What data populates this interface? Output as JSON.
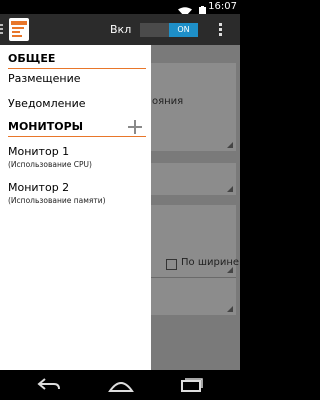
{
  "status_bar": {
    "time": "16:07",
    "wifi_icon": "wifi-icon",
    "battery_icon": "battery-icon"
  },
  "action_bar": {
    "toggle_label": "Вкл",
    "toggle_state": "ON",
    "overflow_icon": "overflow-menu-icon"
  },
  "background": {
    "card1_text": "ояния",
    "checkbox_label": "По ширине"
  },
  "drawer": {
    "general_header": "ОБЩЕЕ",
    "items": [
      {
        "label": "Размещение"
      },
      {
        "label": "Уведомление"
      }
    ],
    "monitors_header": "МОНИТОРЫ",
    "monitors": [
      {
        "title": "Монитор 1",
        "subtitle": "(Использование CPU)"
      },
      {
        "title": "Монитор 2",
        "subtitle": "(Использование памяти)"
      }
    ]
  },
  "colors": {
    "accent": "#e8762a",
    "toggle_on": "#1e8fc8",
    "action_bar": "#2b2b2b"
  }
}
